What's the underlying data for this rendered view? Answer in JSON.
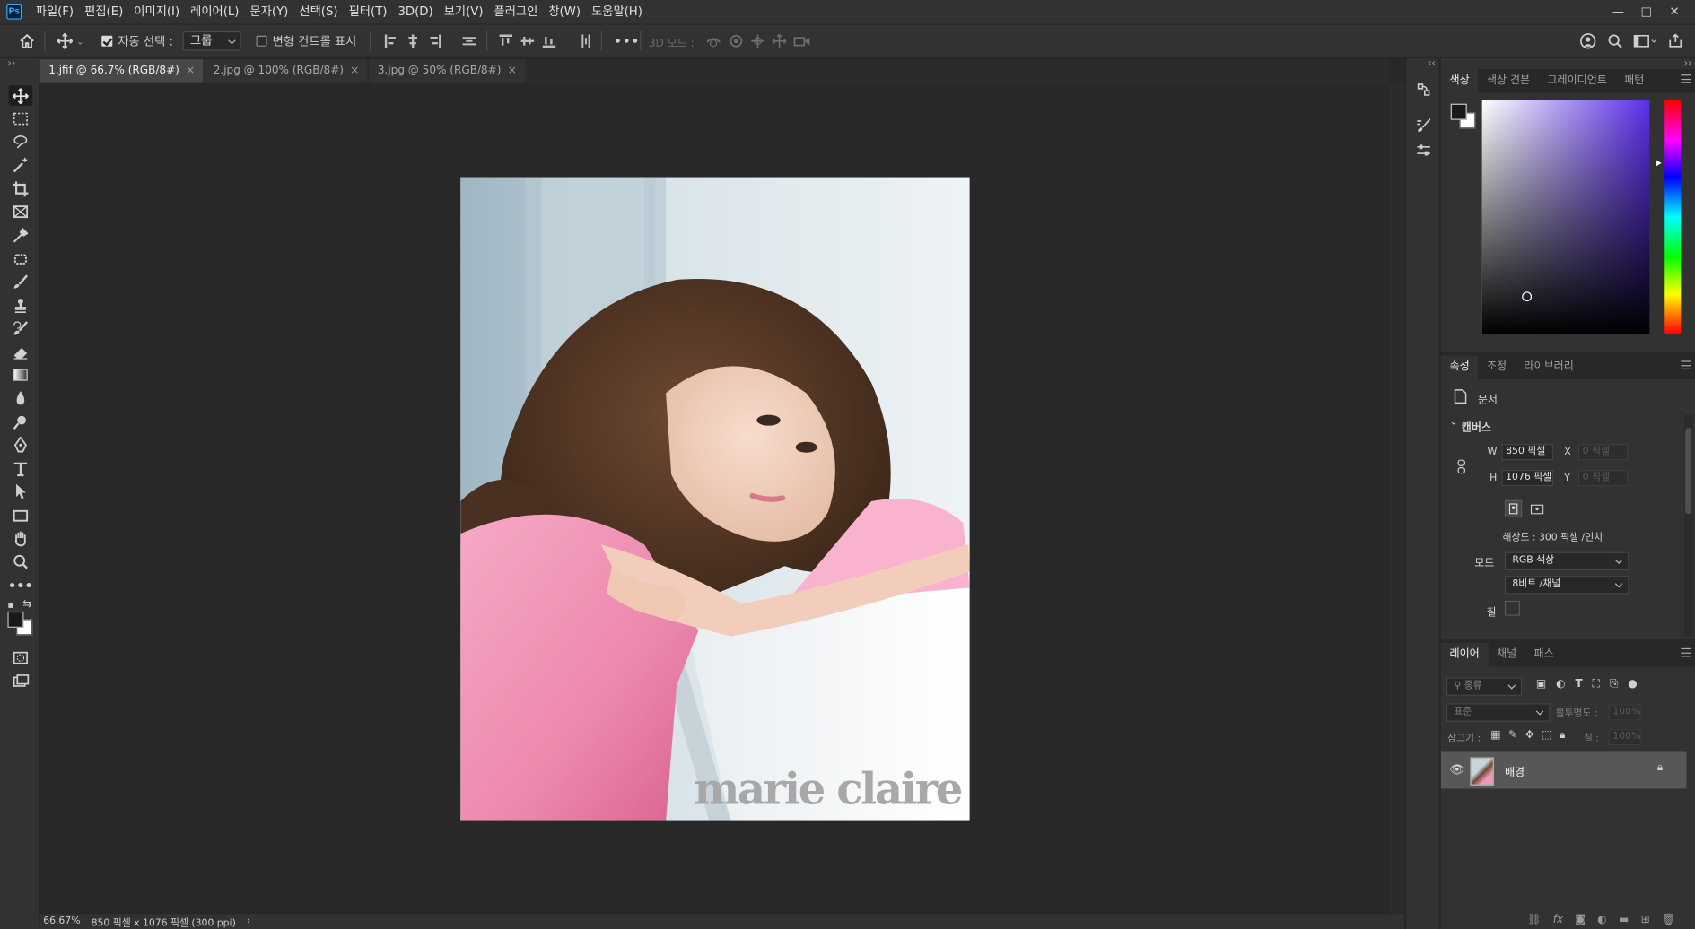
{
  "app": {
    "logo": "Ps"
  },
  "menu": [
    "파일(F)",
    "편집(E)",
    "이미지(I)",
    "레이어(L)",
    "문자(Y)",
    "선택(S)",
    "필터(T)",
    "3D(D)",
    "보기(V)",
    "플러그인",
    "창(W)",
    "도움말(H)"
  ],
  "window_controls": {
    "minimize": "—",
    "maximize": "□",
    "close": "✕"
  },
  "options": {
    "auto_select_label": "자동 선택 :",
    "auto_select_checked": true,
    "auto_select_target": "그룹",
    "transform_controls_label": "변형 컨트롤 표시",
    "transform_controls_checked": false,
    "more": "•••",
    "mode_3d_label": "3D 모드 :"
  },
  "tabs": [
    {
      "label": "1.jfif @ 66.7% (RGB/8#)",
      "active": true,
      "close": "×"
    },
    {
      "label": "2.jpg @ 100% (RGB/8#)",
      "active": false,
      "close": "×"
    },
    {
      "label": "3.jpg @ 50% (RGB/8#)",
      "active": false,
      "close": "×"
    }
  ],
  "image": {
    "watermark": "marie claire"
  },
  "status": {
    "zoom": "66.67%",
    "doc_info": "850 픽셀 x 1076 픽셀 (300 ppi)",
    "arrow": "›"
  },
  "color_panel": {
    "tabs": [
      "색상",
      "색상 견본",
      "그레이디언트",
      "패턴"
    ],
    "foreground": "#1a1a1a",
    "background": "#ffffff",
    "hue_color": "#5b2ee8"
  },
  "properties_panel": {
    "tabs": [
      "속성",
      "조정",
      "라이브러리"
    ],
    "doc_label": "문서",
    "section": "캔버스",
    "w_label": "W",
    "w_value": "850 픽셀",
    "h_label": "H",
    "h_value": "1076 픽셀",
    "x_label": "X",
    "x_value": "0 픽셀",
    "y_label": "Y",
    "y_value": "0 픽셀",
    "resolution": "해상도 : 300 픽셀 /인치",
    "mode_label": "모드",
    "mode_value": "RGB 색상",
    "bit_value": "8비트 /채널",
    "fill_label": "칠"
  },
  "layers_panel": {
    "tabs": [
      "레이어",
      "채널",
      "패스"
    ],
    "filter_placeholder": "종류",
    "blend_mode": "표준",
    "opacity_label": "불투명도 :",
    "opacity_value": "100%",
    "lock_label": "잠그기 :",
    "fill_label": "칠 :",
    "fill_value": "100%",
    "layers": [
      {
        "name": "배경",
        "visible": true,
        "locked": true
      }
    ]
  }
}
